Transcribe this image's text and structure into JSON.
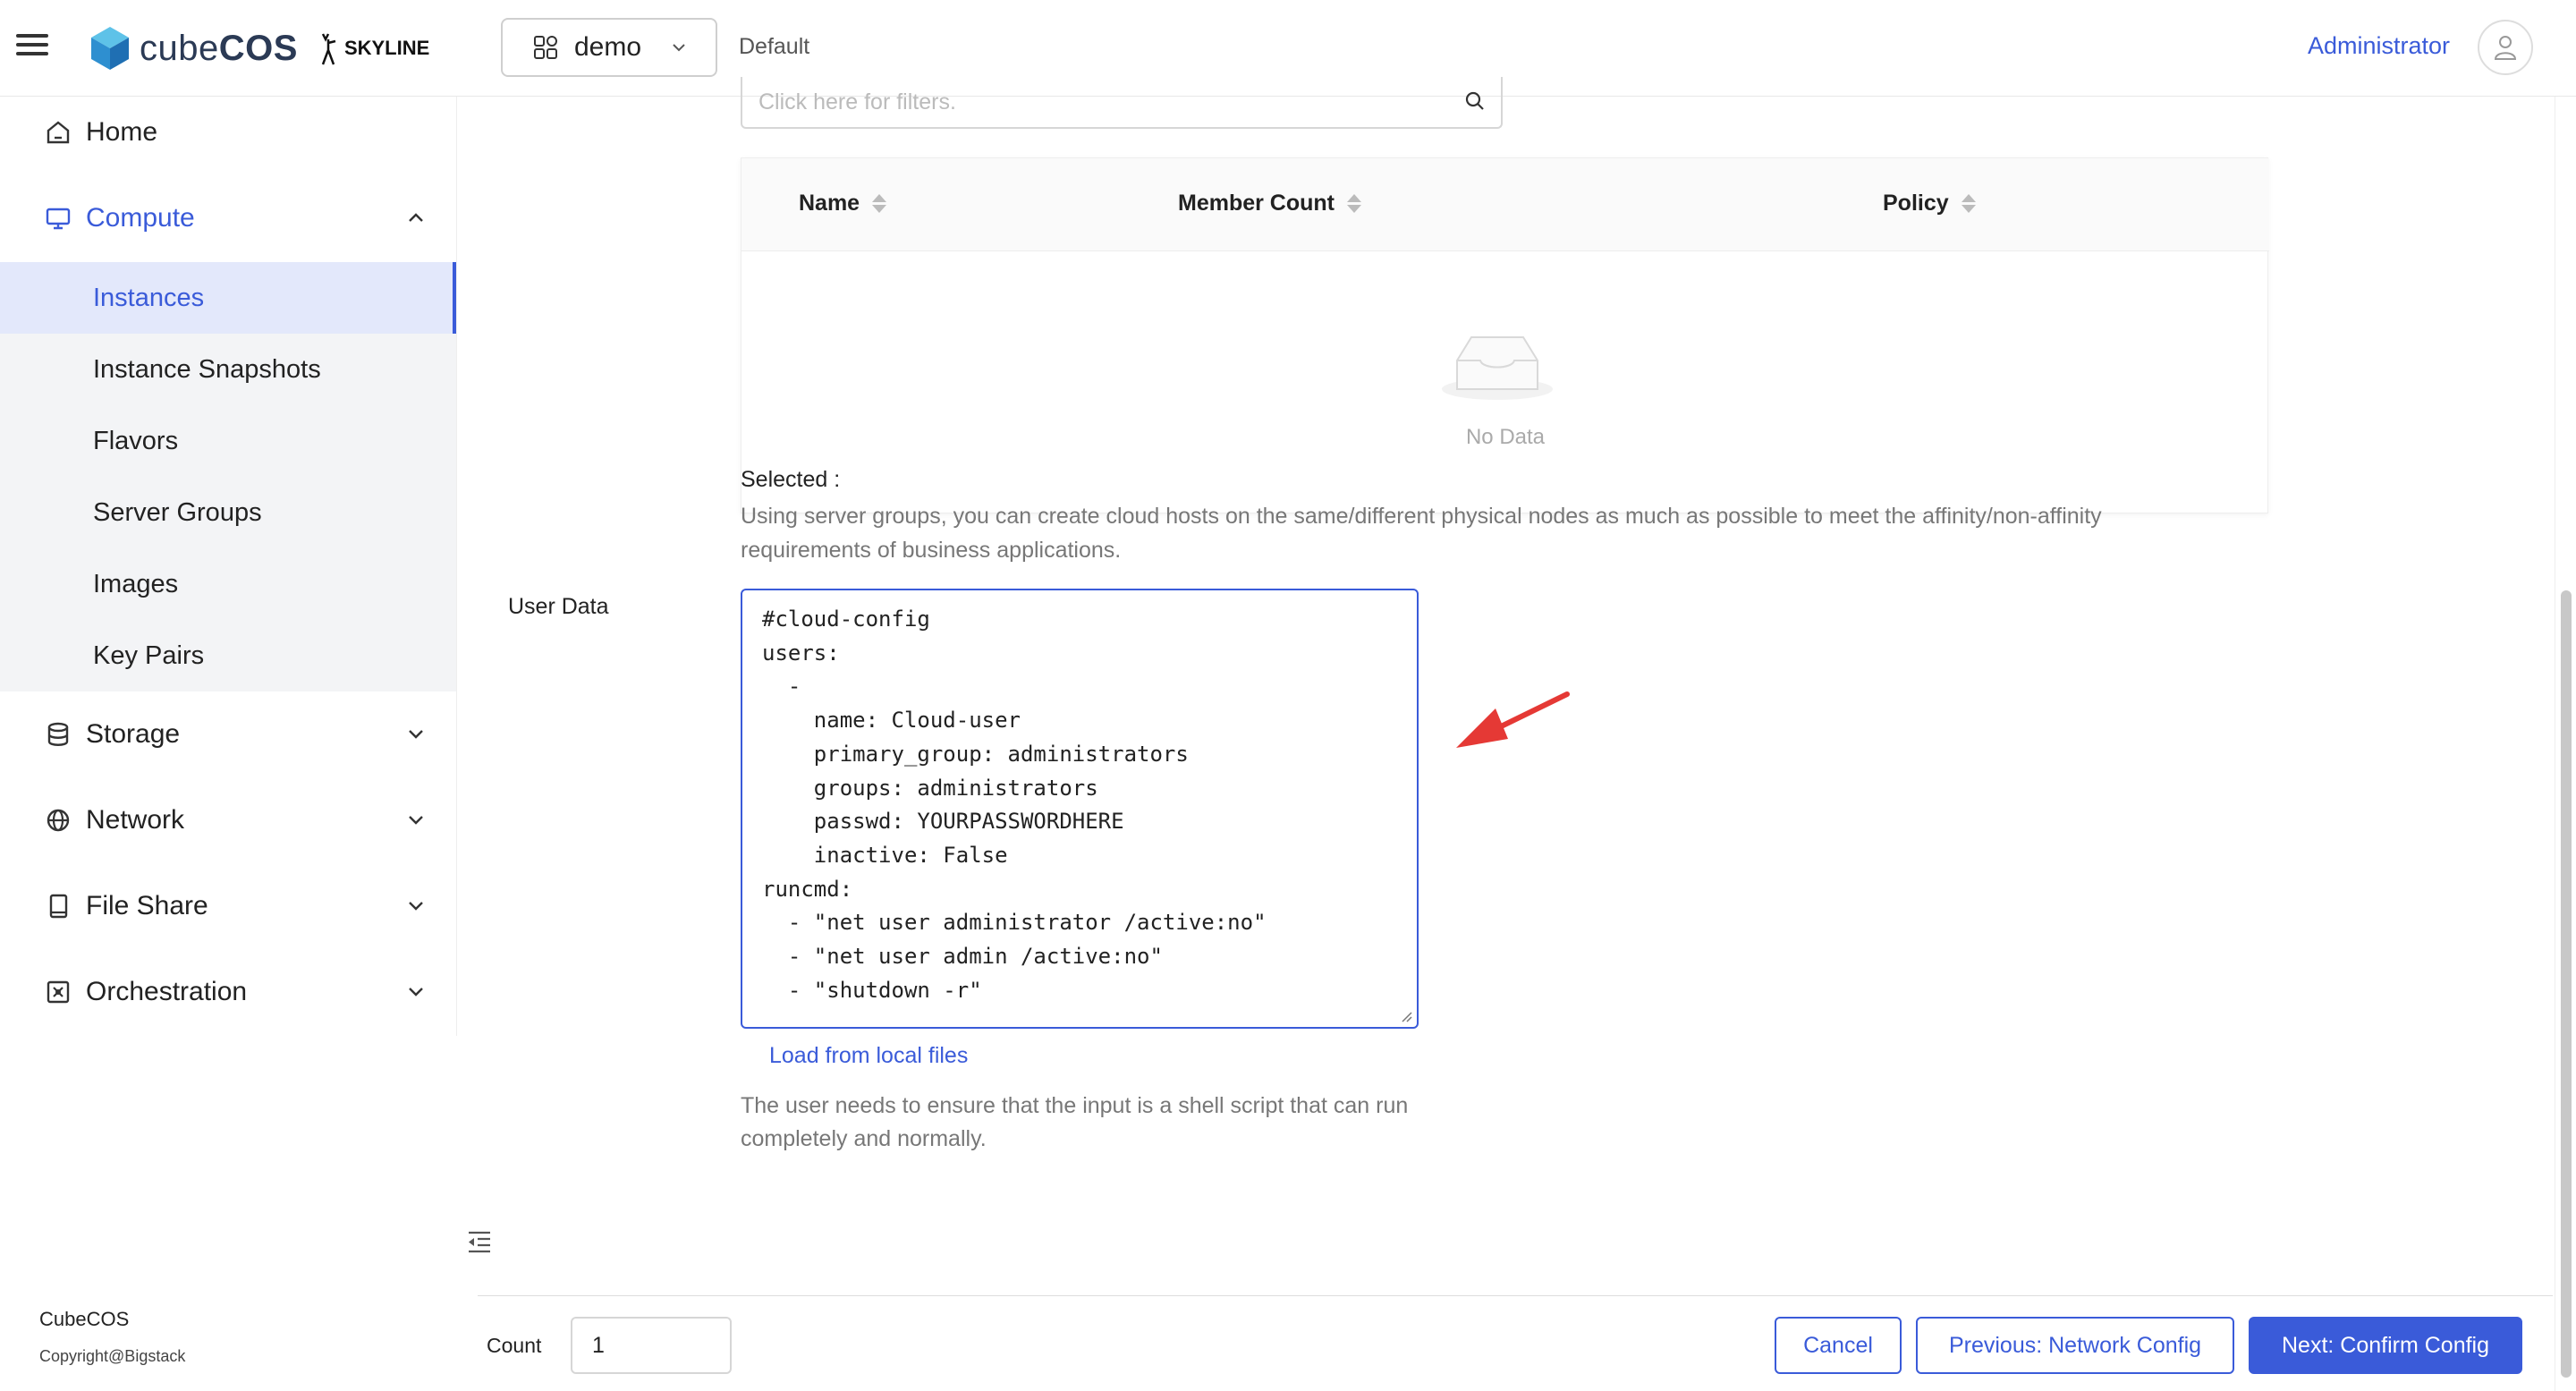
{
  "header": {
    "brand": "cubeCOS",
    "brand_prefix": "cube",
    "brand_suffix": "COS",
    "partner_logo": "SKYLINE",
    "project": "demo",
    "domain": "Default",
    "user": "Administrator"
  },
  "sidebar": {
    "items": [
      {
        "label": "Home",
        "icon": "home-icon"
      },
      {
        "label": "Compute",
        "icon": "monitor-icon"
      },
      {
        "label": "Storage",
        "icon": "database-icon"
      },
      {
        "label": "Network",
        "icon": "globe-icon"
      },
      {
        "label": "File Share",
        "icon": "file-icon"
      },
      {
        "label": "Orchestration",
        "icon": "orchestration-icon"
      }
    ],
    "compute_subitems": [
      "Instances",
      "Instance Snapshots",
      "Flavors",
      "Server Groups",
      "Images",
      "Key Pairs"
    ],
    "footer_title": "CubeCOS",
    "footer_copyright": "Copyright@Bigstack"
  },
  "server_group": {
    "filter_placeholder": "Click here for filters.",
    "columns": [
      "Name",
      "Member Count",
      "Policy"
    ],
    "empty_text": "No Data",
    "selected_label": "Selected :",
    "help": "Using server groups, you can create cloud hosts on the same/different physical nodes as much as possible to meet the affinity/non-affinity requirements of business applications."
  },
  "user_data": {
    "label": "User Data",
    "content": "#cloud-config\nusers:\n  -\n    name: Cloud-user\n    primary_group: administrators\n    groups: administrators\n    passwd: YOURPASSWORDHERE\n    inactive: False\nruncmd:\n  - \"net user administrator /active:no\"\n  - \"net user admin /active:no\"\n  - \"shutdown -r\"",
    "load_link": "Load from local files",
    "help": "The user needs to ensure that the input is a shell script that can run completely and normally."
  },
  "footer": {
    "count_label": "Count",
    "count_value": "1",
    "cancel": "Cancel",
    "previous": "Previous: Network Config",
    "next": "Next: Confirm Config"
  },
  "colors": {
    "accent": "#3a5bd9",
    "selected_bg": "#e3e8fb",
    "annotation_arrow": "#e53935"
  }
}
